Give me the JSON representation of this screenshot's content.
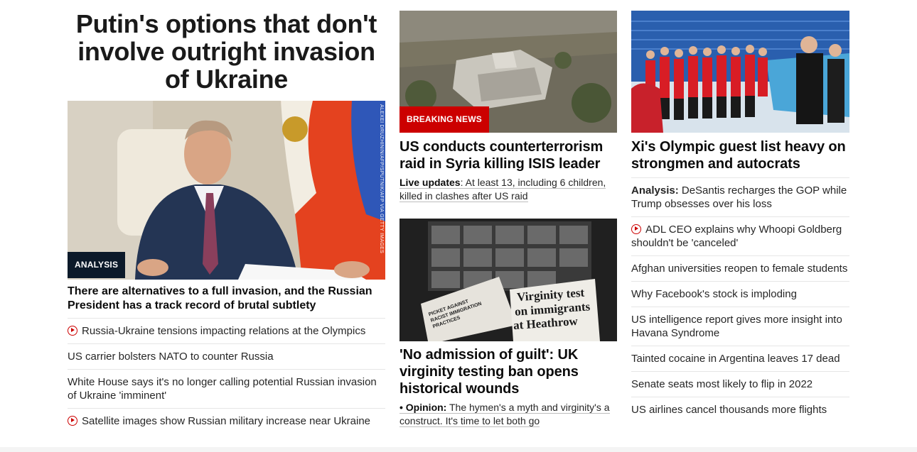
{
  "col1": {
    "main_headline": "Putin's options that don't involve outright invasion of Ukraine",
    "image_credit": "ALEXEI DRUZHININ/AFP/SPUTNIK/AFP VIA GETTY IMAGES",
    "label": "ANALYSIS",
    "sub_headline": "There are alternatives to a full invasion, and the Russian President has a track record of brutal subtlety",
    "links": [
      {
        "text": "Russia-Ukraine tensions impacting relations at the Olympics",
        "video": true
      },
      {
        "text": "US carrier bolsters NATO to counter Russia",
        "video": false
      },
      {
        "text": "White House says it's no longer calling potential Russian invasion of Ukraine 'imminent'",
        "video": false
      },
      {
        "text": "Satellite images show Russian military increase near Ukraine",
        "video": true
      }
    ]
  },
  "col2": {
    "story1": {
      "label": "BREAKING NEWS",
      "headline": "US conducts counterterrorism raid in Syria killing ISIS leader",
      "sub_label": "Live updates",
      "sub_text": ": At least 13, including 6 children, killed in clashes after US raid"
    },
    "story2": {
      "headline": "'No admission of guilt': UK virginity testing ban opens historical wounds",
      "bullet": "•",
      "sub_label": "Opinion:",
      "sub_text": " The hymen's a myth and virginity's a construct. It's time to let both go",
      "clip_text_1": "Virginity test",
      "clip_text_2": "on immigrants",
      "clip_text_3": "at Heathrow",
      "clip_text_4": "PICKET AGAINST RACIST IMMIGRATION PRACTICES"
    }
  },
  "col3": {
    "headline": "Xi's Olympic guest list heavy on strongmen and autocrats",
    "links": [
      {
        "label": "Analysis:",
        "text": " DeSantis recharges the GOP while Trump obsesses over his loss",
        "video": false
      },
      {
        "label": "",
        "text": "ADL CEO explains why Whoopi Goldberg shouldn't be 'canceled'",
        "video": true
      },
      {
        "label": "",
        "text": "Afghan universities reopen to female students",
        "video": false
      },
      {
        "label": "",
        "text": "Why Facebook's stock is imploding",
        "video": false
      },
      {
        "label": "",
        "text": "US intelligence report gives more insight into Havana Syndrome",
        "video": false
      },
      {
        "label": "",
        "text": "Tainted cocaine in Argentina leaves 17 dead",
        "video": false
      },
      {
        "label": "",
        "text": "Senate seats most likely to flip in 2022",
        "video": false
      },
      {
        "label": "",
        "text": "US airlines cancel thousands more flights",
        "video": false
      }
    ]
  },
  "colors": {
    "accent_red": "#cc0000",
    "analysis_navy": "#0c1a2a",
    "text": "#0c0c0c",
    "divider": "#e6e6e6"
  }
}
